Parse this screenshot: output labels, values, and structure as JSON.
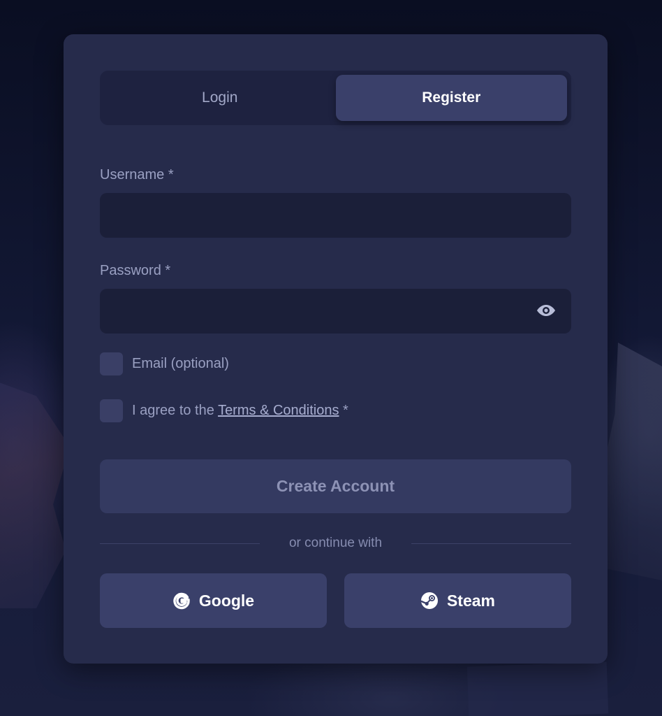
{
  "tabs": [
    {
      "label": "Login",
      "active": false
    },
    {
      "label": "Register",
      "active": true
    }
  ],
  "form": {
    "username_label": "Username *",
    "username_value": "",
    "password_label": "Password *",
    "password_value": "",
    "email_option_label": "Email (optional)",
    "email_checked": false,
    "terms_prefix": "I agree to the ",
    "terms_link": "Terms & Conditions",
    "terms_suffix": " *",
    "terms_checked": false,
    "create_button": "Create Account"
  },
  "divider": {
    "text": "or continue with"
  },
  "social": {
    "google_label": "Google",
    "steam_label": "Steam"
  },
  "icons": {
    "password_toggle": "eye-icon",
    "google": "google-icon",
    "steam": "steam-icon"
  },
  "colors": {
    "page_bg": "#0d1126",
    "card_bg": "#262b4b",
    "input_bg": "#1b1f39",
    "active_tab": "#3a406a",
    "button_bg": "#343a61"
  }
}
